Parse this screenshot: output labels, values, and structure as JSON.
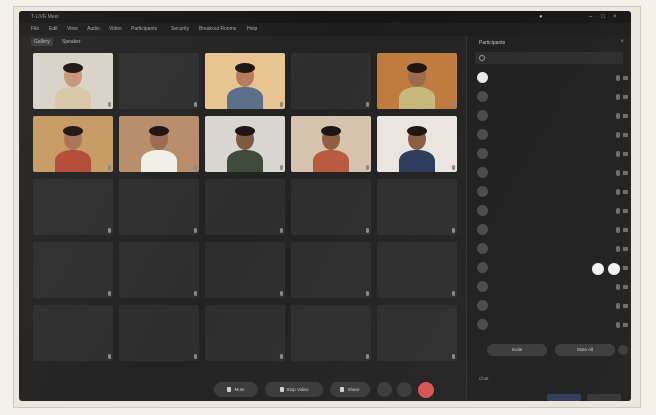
{
  "window": {
    "title": "T-LIVE Meet"
  },
  "menu": {
    "items": [
      "File",
      "Edit",
      "View",
      "Audio",
      "Video",
      "Participants",
      "Security",
      "Breakout Rooms",
      "Help"
    ]
  },
  "view": {
    "tabs": [
      "Gallery",
      "Speaker"
    ]
  },
  "tiles": [
    {
      "name": "",
      "type": "video",
      "skin": "#c69676",
      "shirt": "#d8c6a8",
      "bg": "#d9d2c6"
    },
    {
      "name": "",
      "type": "name"
    },
    {
      "name": "",
      "type": "video",
      "skin": "#b47c5c",
      "shirt": "#5b6f8b",
      "bg": "#e7c48f"
    },
    {
      "name": "",
      "type": "name"
    },
    {
      "name": "",
      "type": "video",
      "skin": "#9a6a4e",
      "shirt": "#c7b87a",
      "bg": "#c07b3d"
    },
    {
      "name": "",
      "type": "video",
      "skin": "#a97355",
      "shirt": "#b34b37",
      "bg": "#c79a62"
    },
    {
      "name": "",
      "type": "video",
      "skin": "#9d6a4e",
      "shirt": "#f0efe9",
      "bg": "#b78d69"
    },
    {
      "name": "",
      "type": "video",
      "skin": "#7e5a43",
      "shirt": "#3e4a3a",
      "bg": "#d8d6d1"
    },
    {
      "name": "",
      "type": "video",
      "skin": "#8d5f44",
      "shirt": "#b85a3d",
      "bg": "#d5c3ad"
    },
    {
      "name": "",
      "type": "video",
      "skin": "#8a5d43",
      "shirt": "#2b3b5b",
      "bg": "#eae6df"
    },
    {
      "name": "",
      "type": "name"
    },
    {
      "name": "",
      "type": "name"
    },
    {
      "name": "",
      "type": "name"
    },
    {
      "name": "",
      "type": "name"
    },
    {
      "name": "",
      "type": "name"
    },
    {
      "name": "",
      "type": "name"
    },
    {
      "name": "",
      "type": "name"
    },
    {
      "name": "",
      "type": "name"
    },
    {
      "name": "",
      "type": "name"
    },
    {
      "name": "",
      "type": "name"
    },
    {
      "name": "",
      "type": "name"
    },
    {
      "name": "",
      "type": "name"
    },
    {
      "name": "",
      "type": "name"
    },
    {
      "name": "",
      "type": "name"
    },
    {
      "name": "",
      "type": "name"
    }
  ],
  "participants_panel": {
    "title": "Participants",
    "search_placeholder": "",
    "items": [
      {
        "name": "",
        "sub": ""
      },
      {
        "name": "",
        "sub": ""
      },
      {
        "name": "",
        "sub": ""
      },
      {
        "name": "",
        "sub": ""
      },
      {
        "name": "",
        "sub": ""
      },
      {
        "name": "",
        "sub": ""
      },
      {
        "name": "",
        "sub": ""
      },
      {
        "name": "",
        "sub": ""
      },
      {
        "name": "",
        "sub": ""
      },
      {
        "name": "",
        "sub": ""
      },
      {
        "name": "",
        "sub": ""
      },
      {
        "name": "",
        "sub": ""
      },
      {
        "name": "",
        "sub": ""
      },
      {
        "name": "",
        "sub": ""
      }
    ],
    "invite_label": "Invite",
    "mute_all_label": "Mute All",
    "footer_label": "Chat"
  },
  "toolbar": {
    "mute_label": "Mute",
    "video_label": "Stop Video",
    "share_label": "Share"
  },
  "colors": {
    "screen_bg": "#232323",
    "tile_bg": "#2e2e2e",
    "leave_red": "#d9534f"
  }
}
